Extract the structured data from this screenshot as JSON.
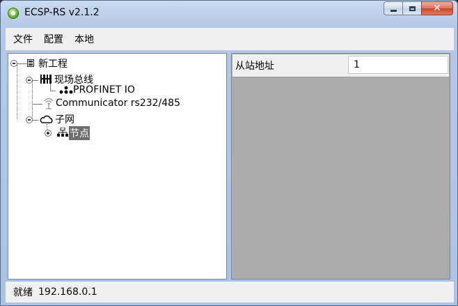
{
  "window": {
    "title": "ECSP-RS v2.1.2"
  },
  "menu": [
    "文件",
    "配置",
    "本地"
  ],
  "tree": {
    "root": "新工程",
    "fieldbus": "现场总线",
    "profinet": "PROFINET IO",
    "communicator": "Communicator rs232/485",
    "subnet": "子网",
    "node": "节点"
  },
  "properties": {
    "label": "从站地址",
    "value": "1"
  },
  "status": {
    "text": "就绪",
    "ip": "192.168.0.1"
  }
}
